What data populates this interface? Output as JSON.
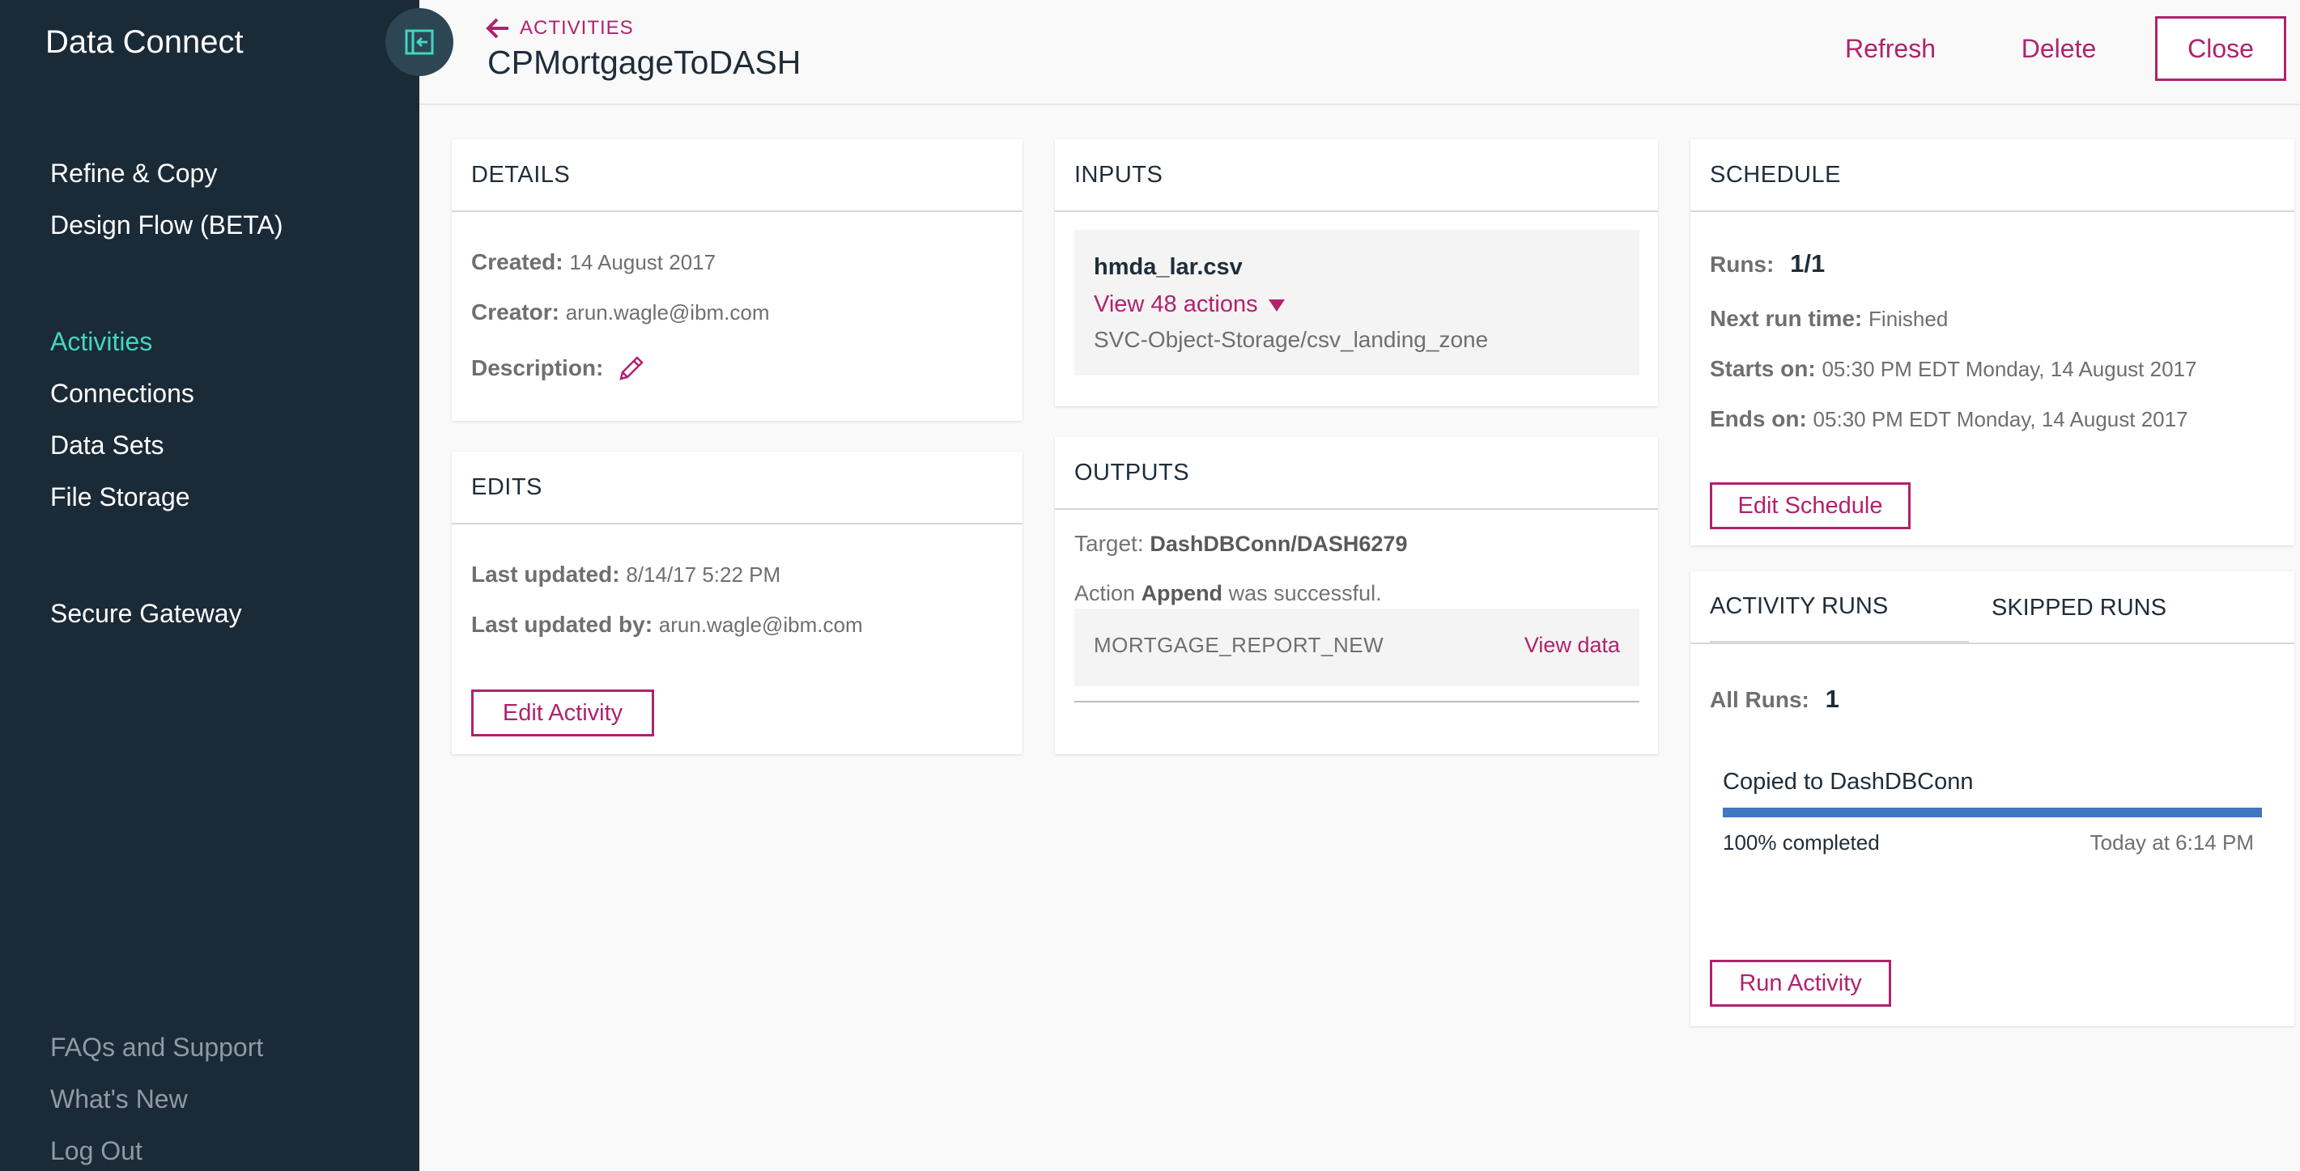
{
  "app": {
    "title": "Data Connect"
  },
  "sidebar": {
    "items": [
      {
        "label": "Refine & Copy"
      },
      {
        "label": "Design Flow (BETA)"
      },
      {
        "label": "Activities"
      },
      {
        "label": "Connections"
      },
      {
        "label": "Data Sets"
      },
      {
        "label": "File Storage"
      },
      {
        "label": "Secure Gateway"
      }
    ],
    "footer": [
      {
        "label": "FAQs and Support"
      },
      {
        "label": "What's New"
      },
      {
        "label": "Log Out"
      }
    ]
  },
  "header": {
    "back_label": "ACTIVITIES",
    "title": "CPMortgageToDASH",
    "refresh_label": "Refresh",
    "delete_label": "Delete",
    "close_label": "Close"
  },
  "details": {
    "heading": "DETAILS",
    "created_label": "Created:",
    "created_value": "14 August 2017",
    "creator_label": "Creator:",
    "creator_value": "arun.wagle@ibm.com",
    "description_label": "Description:"
  },
  "edits": {
    "heading": "EDITS",
    "last_updated_label": "Last updated:",
    "last_updated_value": "8/14/17 5:22 PM",
    "last_updated_by_label": "Last updated by:",
    "last_updated_by_value": "arun.wagle@ibm.com",
    "edit_button": "Edit Activity"
  },
  "inputs": {
    "heading": "INPUTS",
    "file_name": "hmda_lar.csv",
    "actions_link": "View 48 actions",
    "path": "SVC-Object-Storage/csv_landing_zone"
  },
  "outputs": {
    "heading": "OUTPUTS",
    "target_label": "Target:",
    "target_value": "DashDBConn/DASH6279",
    "action_prefix": "Action",
    "action_name": "Append",
    "action_suffix": "was successful.",
    "table_name": "MORTGAGE_REPORT_NEW",
    "view_data": "View data"
  },
  "schedule": {
    "heading": "SCHEDULE",
    "runs_label": "Runs:",
    "runs_value": "1/1",
    "next_run_label": "Next run time:",
    "next_run_value": "Finished",
    "starts_label": "Starts on:",
    "starts_value": "05:30 PM EDT Monday, 14 August 2017",
    "ends_label": "Ends on:",
    "ends_value": "05:30 PM EDT Monday, 14 August 2017",
    "edit_button": "Edit Schedule"
  },
  "runs": {
    "tab_activity": "ACTIVITY RUNS",
    "tab_skipped": "SKIPPED RUNS",
    "all_runs_label": "All Runs:",
    "all_runs_value": "1",
    "run_title": "Copied to DashDBConn",
    "progress_percent": 100,
    "progress_text": "100% completed",
    "run_time": "Today at 6:14 PM",
    "run_button": "Run Activity"
  },
  "colors": {
    "sidebar_bg": "#1b2a37",
    "accent": "#b0226d",
    "active_nav": "#41d6c3",
    "progress": "#4177c1"
  }
}
